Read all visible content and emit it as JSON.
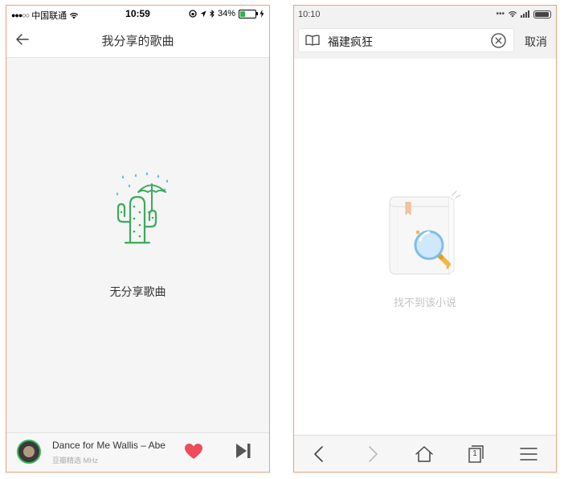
{
  "left_screen": {
    "status": {
      "carrier": "中国联通",
      "signal_dots": "●●●○○",
      "time": "10:59",
      "battery": "34%"
    },
    "nav": {
      "title": "我分享的歌曲"
    },
    "empty_state": {
      "icon": "cactus-umbrella-icon",
      "message": "无分享歌曲"
    },
    "player": {
      "song": "Dance for Me Wallis – Abe",
      "source": "豆瓣精选 MHz",
      "accent": "#f04b5b"
    }
  },
  "right_screen": {
    "status": {
      "time": "10:10"
    },
    "search": {
      "query": "福建疯狂",
      "cancel_label": "取消"
    },
    "empty_state": {
      "icon": "book-magnifier-icon",
      "message": "找不到该小说"
    },
    "toolbar": {
      "tabs_count": "1"
    }
  }
}
